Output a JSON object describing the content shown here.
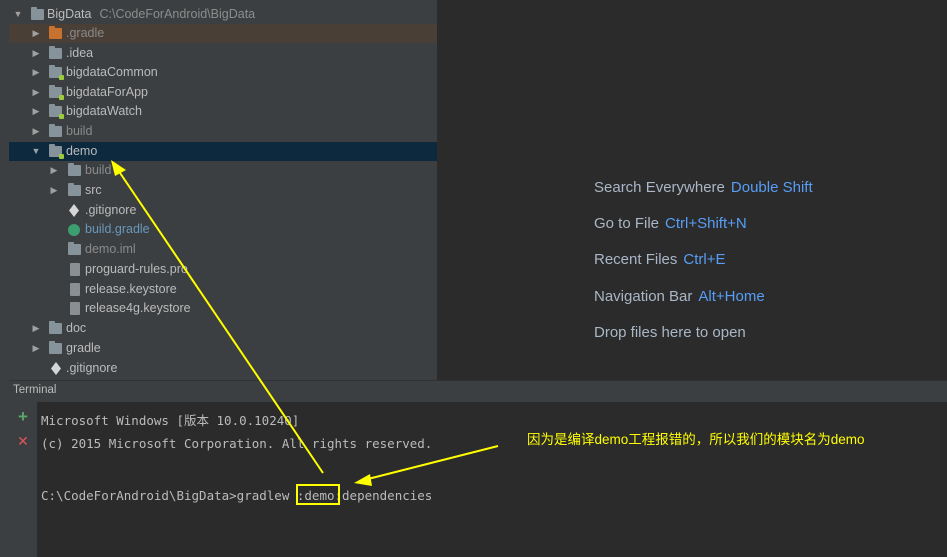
{
  "project": {
    "root_name": "BigData",
    "root_path": "C:\\CodeForAndroid\\BigData",
    "items": [
      {
        "label": ".gradle"
      },
      {
        "label": ".idea"
      },
      {
        "label": "bigdataCommon"
      },
      {
        "label": "bigdataForApp"
      },
      {
        "label": "bigdataWatch"
      },
      {
        "label": "build"
      },
      {
        "label": "demo"
      },
      {
        "label": "build"
      },
      {
        "label": "src"
      },
      {
        "label": ".gitignore"
      },
      {
        "label": "build.gradle"
      },
      {
        "label": "demo.iml"
      },
      {
        "label": "proguard-rules.pro"
      },
      {
        "label": "release.keystore"
      },
      {
        "label": "release4g.keystore"
      },
      {
        "label": "doc"
      },
      {
        "label": "gradle"
      },
      {
        "label": ".gitignore"
      }
    ]
  },
  "editor": {
    "hints": [
      {
        "label": "Search Everywhere",
        "shortcut": "Double Shift"
      },
      {
        "label": "Go to File",
        "shortcut": "Ctrl+Shift+N"
      },
      {
        "label": "Recent Files",
        "shortcut": "Ctrl+E"
      },
      {
        "label": "Navigation Bar",
        "shortcut": "Alt+Home"
      },
      {
        "label": "Drop files here to open",
        "shortcut": ""
      }
    ]
  },
  "terminal": {
    "title": "Terminal",
    "add_label": "+",
    "close_label": "✕",
    "lines": [
      "Microsoft Windows [版本 10.0.10240]",
      "(c) 2015 Microsoft Corporation. All rights reserved.",
      "C:\\CodeForAndroid\\BigData>gradlew :demo:dependencies"
    ]
  },
  "annotation": {
    "text": "因为是编译demo工程报错的，所以我们的模块名为demo",
    "color": "#ffff00"
  },
  "colors": {
    "selection": "#0d293e",
    "shortcut": "#589df6",
    "add": "#59a869",
    "close": "#e05555"
  }
}
